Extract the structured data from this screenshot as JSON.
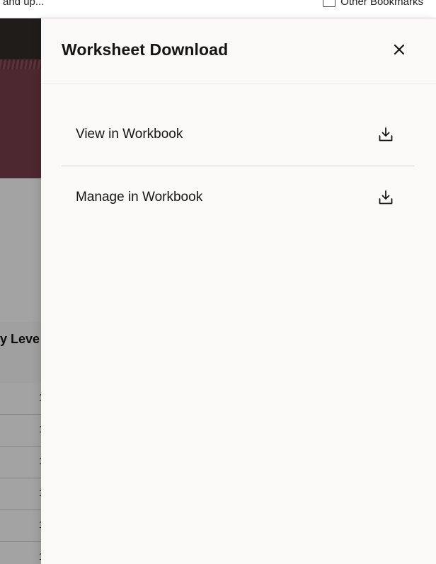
{
  "browser": {
    "bookmark_left": "and up...",
    "bookmark_right": "Other Bookmarks",
    "bookmark_right_icon": "folder-icon"
  },
  "background_app": {
    "table_header_label": "y Leve",
    "row_digits": [
      "1",
      "1",
      "1",
      "1",
      "1",
      "1"
    ]
  },
  "drawer": {
    "title": "Worksheet Download",
    "close_icon": "close-icon",
    "items": [
      {
        "label": "View in Workbook",
        "icon": "download-icon"
      },
      {
        "label": "Manage in Workbook",
        "icon": "download-icon"
      }
    ]
  },
  "colors": {
    "header_dark": "#312d2a",
    "banner": "#7a3f4c",
    "drawer_bg": "#fbf9f8",
    "text": "#161513"
  }
}
